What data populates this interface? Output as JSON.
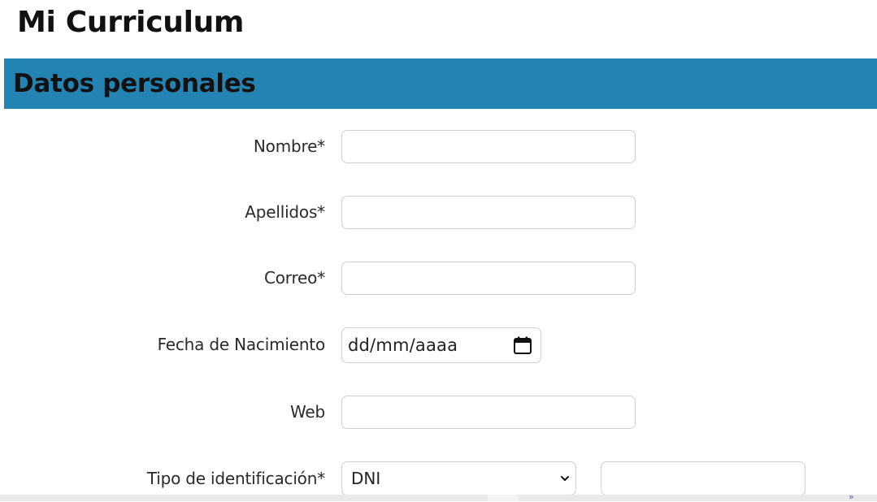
{
  "page": {
    "title": "Mi Curriculum"
  },
  "section": {
    "title": "Datos personales",
    "background": "#2383b3"
  },
  "form": {
    "fields": [
      {
        "label": "Nombre*",
        "value": ""
      },
      {
        "label": "Apellidos*",
        "value": ""
      },
      {
        "label": "Correo*",
        "value": ""
      },
      {
        "label": "Fecha de Nacimiento",
        "value": "dd/mm/aaaa",
        "icon": "calendar-icon"
      },
      {
        "label": "Web",
        "value": ""
      },
      {
        "label": "Tipo de identificación*",
        "selected": "DNI",
        "icon": "chevron-down-icon",
        "id_number_value": ""
      }
    ]
  },
  "scroll": {
    "right_icon": "»"
  }
}
